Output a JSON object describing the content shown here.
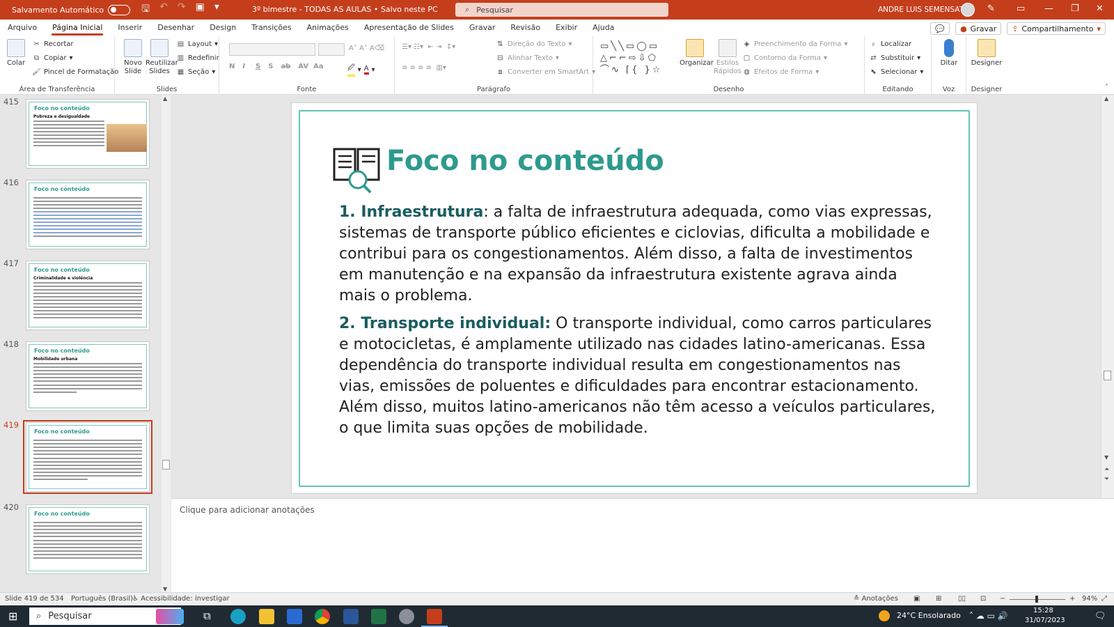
{
  "titlebar": {
    "autosave_label": "Salvamento Automático",
    "doc_title": "3º bimestre - TODAS AS AULAS • Salvo neste PC",
    "search_placeholder": "Pesquisar",
    "user_name": "ANDRE LUIS SEMENSATO"
  },
  "tabs": [
    "Arquivo",
    "Página Inicial",
    "Inserir",
    "Desenhar",
    "Design",
    "Transições",
    "Animações",
    "Apresentação de Slides",
    "Gravar",
    "Revisão",
    "Exibir",
    "Ajuda"
  ],
  "tab_actions": {
    "gravar": "Gravar",
    "compartilhamento": "Compartilhamento"
  },
  "ribbon": {
    "clipboard": {
      "colar": "Colar",
      "recortar": "Recortar",
      "copiar": "Copiar",
      "pincel": "Pincel de Formatação",
      "label": "Área de Transferência"
    },
    "slides": {
      "novo": "Novo Slide",
      "reutilizar": "Reutilizar Slides",
      "layout": "Layout",
      "redefinir": "Redefinir",
      "secao": "Seção",
      "label": "Slides"
    },
    "fonte": {
      "label": "Fonte"
    },
    "paragrafo": {
      "direcao": "Direção do Texto",
      "alinhar": "Alinhar Texto",
      "converter": "Converter em SmartArt",
      "label": "Parágrafo"
    },
    "desenho": {
      "organizar": "Organizar",
      "estilos": "Estilos Rápidos",
      "preenchimento": "Preenchimento da Forma",
      "contorno": "Contorno da Forma",
      "efeitos": "Efeitos de Forma",
      "label": "Desenho"
    },
    "editando": {
      "localizar": "Localizar",
      "substituir": "Substituir",
      "selecionar": "Selecionar",
      "label": "Editando"
    },
    "voz": {
      "ditar": "Ditar",
      "label": "Voz"
    },
    "designer": {
      "designer": "Designer",
      "label": "Designer"
    }
  },
  "thumbnails": [
    {
      "num": "415",
      "title": "Foco no conteúdo",
      "subtitle": "Pobreza e desigualdade"
    },
    {
      "num": "416",
      "title": "Foco no conteúdo",
      "subtitle": ""
    },
    {
      "num": "417",
      "title": "Foco no conteúdo",
      "subtitle": "Criminalidade e violência"
    },
    {
      "num": "418",
      "title": "Foco no conteúdo",
      "subtitle": "Mobilidade urbana"
    },
    {
      "num": "419",
      "title": "Foco no conteúdo",
      "subtitle": ""
    },
    {
      "num": "420",
      "title": "Foco no conteúdo",
      "subtitle": ""
    }
  ],
  "slide": {
    "title": "Foco no conteúdo",
    "p1_lead": "1. Infraestrutura",
    "p1_text": ": a falta de infraestrutura adequada, como vias expressas, sistemas de transporte público eficientes e ciclovias, dificulta a mobilidade e contribui para os congestionamentos. Além disso, a falta de investimentos em manutenção e na expansão da infraestrutura existente agrava ainda mais o problema.",
    "p2_lead": "2. Transporte individual:",
    "p2_text": " O transporte individual, como carros particulares e motocicletas, é amplamente utilizado nas cidades latino-americanas. Essa dependência do transporte individual resulta em congestionamentos nas vias, emissões de poluentes e dificuldades para encontrar estacionamento. Além disso, muitos latino-americanos não têm acesso a veículos particulares, o que limita suas opções de mobilidade."
  },
  "notes_placeholder": "Clique para adicionar anotações",
  "status": {
    "slide_count": "Slide 419 de 534",
    "language": "Português (Brasil)",
    "accessibility": "Acessibilidade: investigar",
    "anotacoes": "Anotações",
    "zoom": "94%"
  },
  "taskbar": {
    "search": "Pesquisar",
    "weather": "24°C  Ensolarado",
    "time": "15:28",
    "date": "31/07/2023"
  },
  "colors": {
    "accent": "#c43e1c",
    "teal": "#2e9a8e",
    "dark_teal": "#1a5c60"
  }
}
